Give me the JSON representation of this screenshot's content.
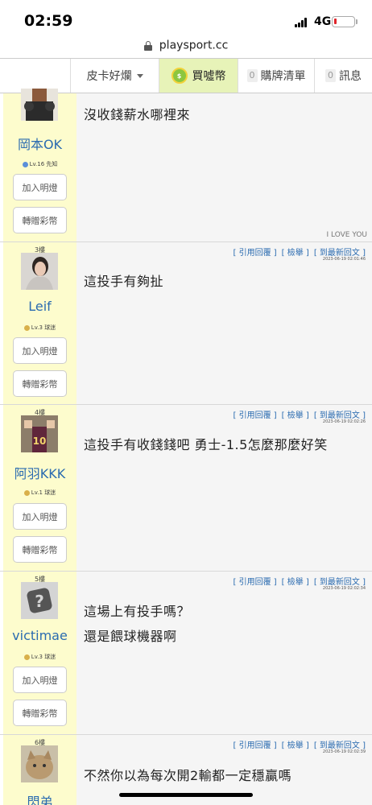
{
  "status_bar": {
    "time": "02:59",
    "network": "4G"
  },
  "browser": {
    "url": "playsport.cc"
  },
  "nav": {
    "items": [
      {
        "label": "皮卡好爛"
      },
      {
        "label": "買噓幣"
      },
      {
        "label": "購牌清單",
        "count": "0"
      },
      {
        "label": "訊息",
        "count": "0"
      }
    ]
  },
  "post_labels": {
    "quote_reply": "[ 引用回覆 ]",
    "report": "[ 檢舉 ]",
    "to_latest": "[ 到最新回文 ]",
    "light_button": "加入明燈",
    "gift_button": "轉贈彩幣"
  },
  "posts": [
    {
      "floor": "",
      "author": "岡本OK",
      "level": "Lv.16 先知",
      "time": "",
      "lines": [
        "沒收錢薪水哪裡來"
      ],
      "signature": "I LOVE YOU"
    },
    {
      "floor": "3樓",
      "author": "Leif",
      "level": "Lv.3 球迷",
      "time": "2023-06-19 02:01:46",
      "lines": [
        "這投手有夠扯"
      ]
    },
    {
      "floor": "4樓",
      "author": "阿羽KKK",
      "level": "Lv.1 球迷",
      "time": "2023-06-19 02:02:26",
      "lines": [
        "這投手有收錢錢吧 勇士-1.5怎麼那麼好笑"
      ]
    },
    {
      "floor": "5樓",
      "author": "victimae",
      "level": "Lv.3 球迷",
      "time": "2023-06-19 02:02:34",
      "lines": [
        "這場上有投手嗎？",
        "還是餵球機器啊"
      ]
    },
    {
      "floor": "6樓",
      "author": "閃弟",
      "level": "",
      "time": "2023-06-19 02:02:39",
      "lines": [
        "不然你以為每次開2輸都一定穩贏嗎"
      ]
    }
  ],
  "colors": {
    "link": "#2a6bb0",
    "author_bg": "#fdfccd",
    "content_bg": "#f5f5f5",
    "buy_bg": "#e7f3b8"
  }
}
